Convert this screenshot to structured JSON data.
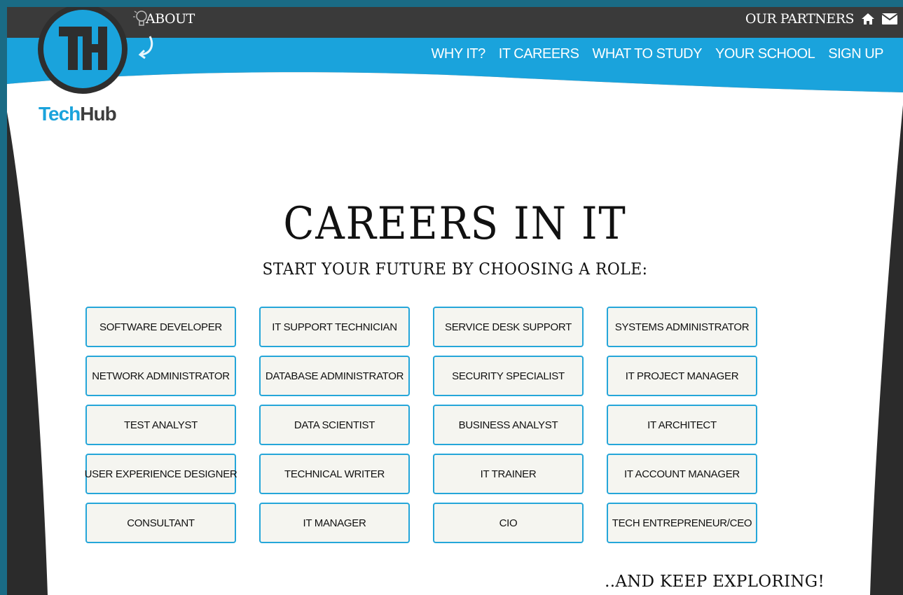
{
  "topbar": {
    "about_label": "ABOUT",
    "partners_label": "OUR PARTNERS",
    "home_icon": "home-icon",
    "mail_icon": "envelope-icon"
  },
  "nav": {
    "items": [
      "WHY IT?",
      "IT CAREERS",
      "WHAT TO STUDY",
      "YOUR SCHOOL",
      "SIGN UP"
    ]
  },
  "logo": {
    "monogram": "TH",
    "brand_tech": "Tech",
    "brand_hub": "Hub"
  },
  "main": {
    "title": "CAREERS IN IT",
    "subtitle": "START YOUR FUTURE BY CHOOSING A ROLE:",
    "roles": [
      "SOFTWARE DEVELOPER",
      "IT SUPPORT TECHNICIAN",
      "SERVICE DESK SUPPORT",
      "SYSTEMS ADMINISTRATOR",
      "NETWORK ADMINISTRATOR",
      "DATABASE ADMINISTRATOR",
      "SECURITY SPECIALIST",
      "IT PROJECT MANAGER",
      "TEST ANALYST",
      "DATA SCIENTIST",
      "BUSINESS ANALYST",
      "IT ARCHITECT",
      "USER EXPERIENCE DESIGNER",
      "TECHNICAL WRITER",
      "IT TRAINER",
      "IT ACCOUNT MANAGER",
      "CONSULTANT",
      "IT MANAGER",
      "CIO",
      "TECH ENTREPRENEUR/CEO"
    ],
    "keep_exploring": "..AND KEEP EXPLORING!"
  },
  "colors": {
    "accent_blue": "#1aa3dc",
    "page_bg": "#ffffff",
    "frame_dark": "#2b2b2b",
    "outer_teal": "#1a6b85"
  }
}
